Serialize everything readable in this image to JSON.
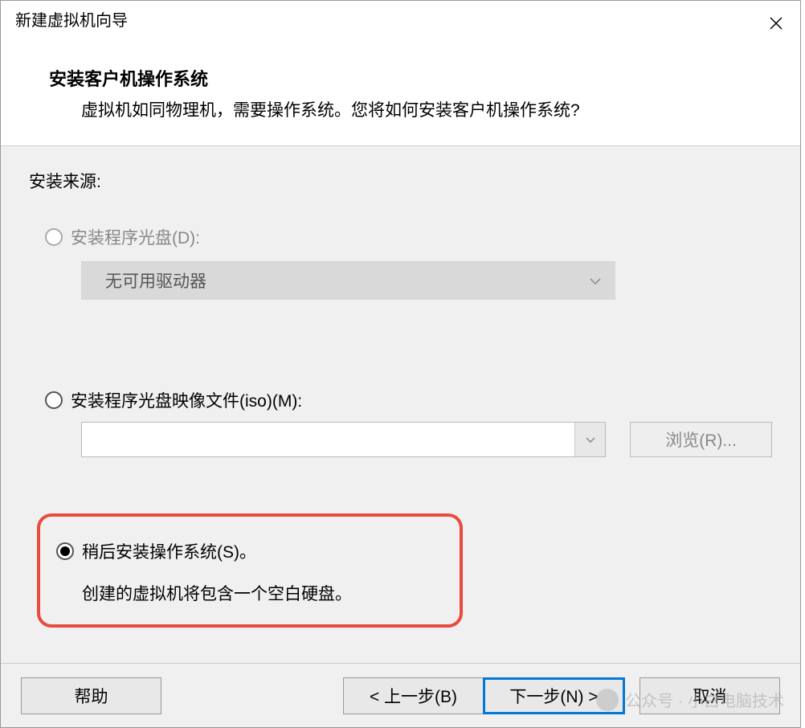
{
  "title_bar": {
    "title": "新建虚拟机向导"
  },
  "header": {
    "title": "安装客户机操作系统",
    "subtitle": "虚拟机如同物理机，需要操作系统。您将如何安装客户机操作系统?"
  },
  "content": {
    "source_label": "安装来源:",
    "option_disc": {
      "label": "安装程序光盘(D):",
      "dropdown_text": "无可用驱动器"
    },
    "option_iso": {
      "label": "安装程序光盘映像文件(iso)(M):",
      "browse_button": "浏览(R)..."
    },
    "option_later": {
      "label": "稍后安装操作系统(S)。",
      "description": "创建的虚拟机将包含一个空白硬盘。"
    }
  },
  "footer": {
    "help": "帮助",
    "prev": "< 上一步(B)",
    "next": "下一步(N) >",
    "cancel": "取消"
  },
  "watermark": {
    "text": "公众号 · 小白电脑技术"
  }
}
